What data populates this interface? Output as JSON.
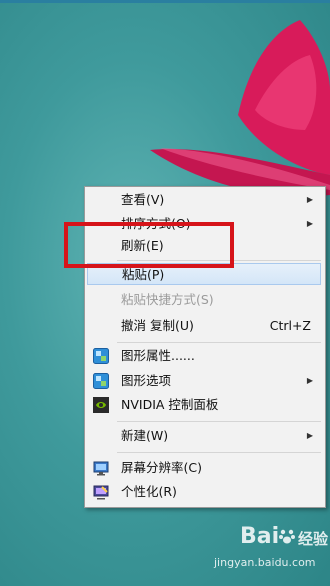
{
  "context_menu": {
    "items": [
      {
        "label": "查看(V)",
        "submenu": true
      },
      {
        "label": "排序方式(O)",
        "submenu": true
      },
      {
        "label": "刷新(E)"
      },
      {
        "label": "粘贴(P)"
      },
      {
        "label": "粘贴快捷方式(S)"
      },
      {
        "label": "撤消 复制(U)",
        "shortcut": "Ctrl+Z"
      },
      {
        "label": "图形属性......",
        "icon": "graphics-icon"
      },
      {
        "label": "图形选项",
        "icon": "graphics-icon",
        "submenu": true
      },
      {
        "label": "NVIDIA 控制面板",
        "icon": "nvidia-icon"
      },
      {
        "label": "新建(W)",
        "submenu": true
      },
      {
        "label": "屏幕分辨率(C)",
        "icon": "monitor-icon"
      },
      {
        "label": "个性化(R)",
        "icon": "personalize-icon"
      }
    ],
    "highlighted_item": "粘贴(P)",
    "disabled_item": "粘贴快捷方式(S)"
  },
  "annotation": {
    "color": "#d6141a"
  },
  "watermark": {
    "brand_text": "Bai",
    "brand_suffix": "经验",
    "url": "jingyan.baidu.com"
  },
  "colors": {
    "desktop_bg": "#3f9a9c",
    "flower": "#d81b5a",
    "menu_bg": "#f2f2f2",
    "highlight": "#d4e6f8"
  }
}
